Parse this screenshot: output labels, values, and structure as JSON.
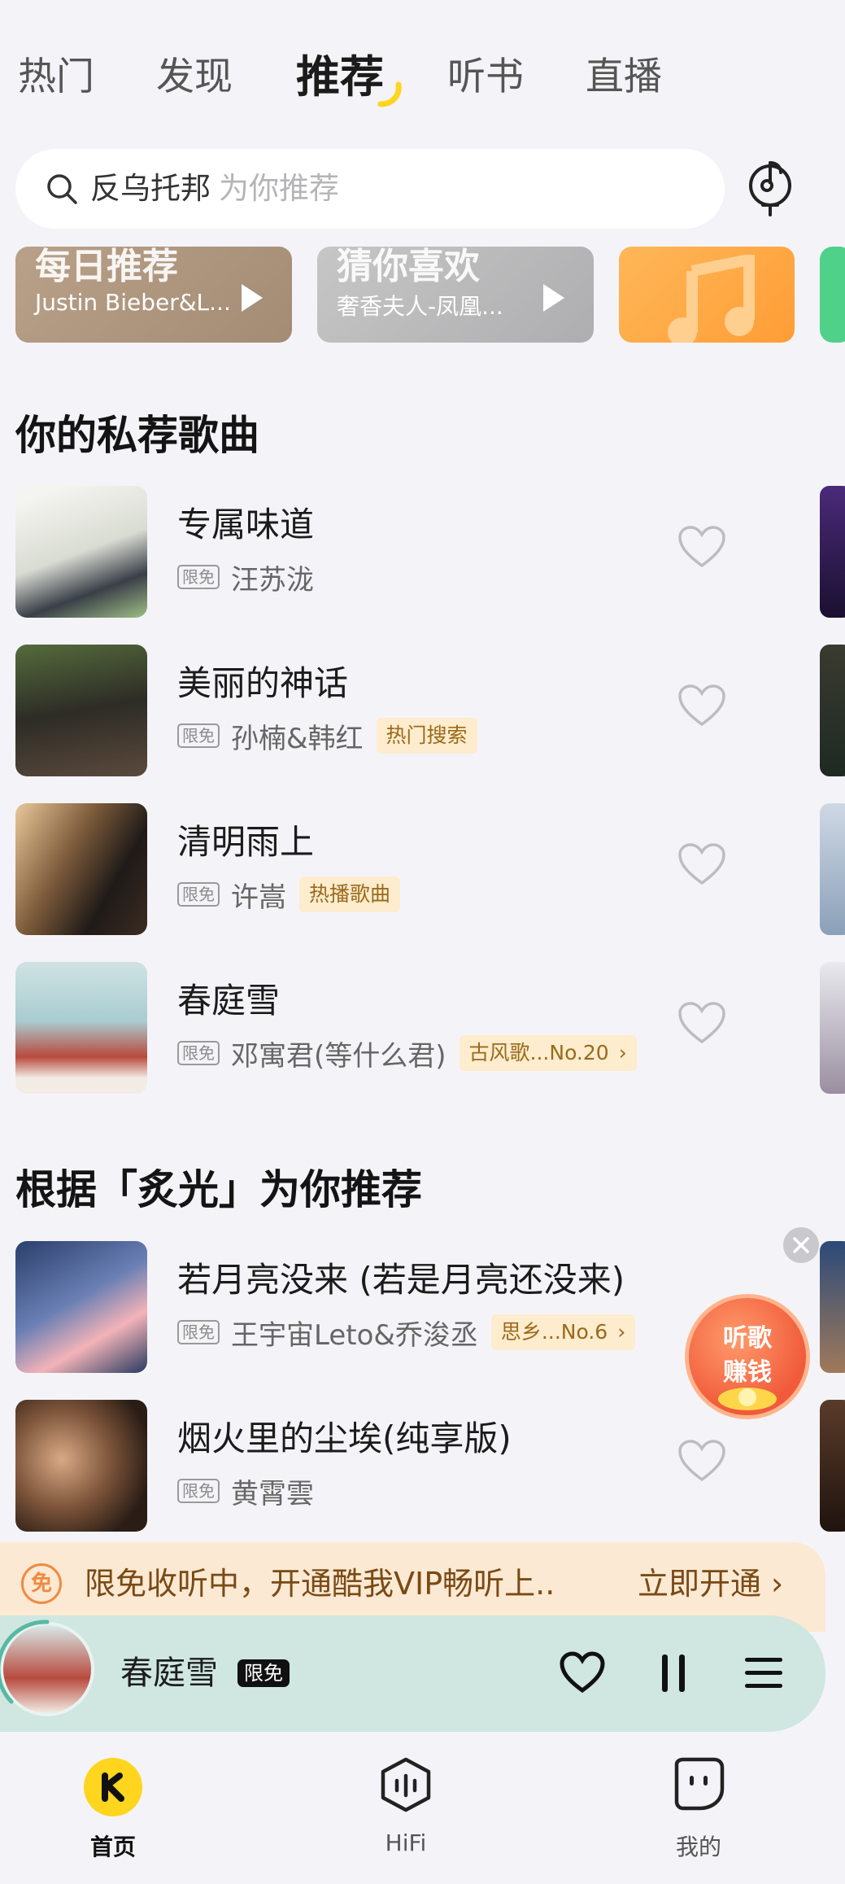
{
  "top_tabs": [
    {
      "label": "热门"
    },
    {
      "label": "发现"
    },
    {
      "label": "推荐"
    },
    {
      "label": "听书"
    },
    {
      "label": "直播"
    }
  ],
  "search": {
    "query": "反乌托邦",
    "placeholder": "为你推荐"
  },
  "banners": [
    {
      "title": "每日推荐",
      "subtitle": "Justin Bieber&L..."
    },
    {
      "title": "猜你喜欢",
      "subtitle": "奢香夫人-凤凰..."
    }
  ],
  "section1": {
    "title": "你的私荐歌曲",
    "songs": [
      {
        "name": "专属味道",
        "free": "限免",
        "artist": "汪苏泷",
        "tag": ""
      },
      {
        "name": "美丽的神话",
        "free": "限免",
        "artist": "孙楠&韩红",
        "tag": "热门搜索"
      },
      {
        "name": "清明雨上",
        "free": "限免",
        "artist": "许嵩",
        "tag": "热播歌曲"
      },
      {
        "name": "春庭雪",
        "free": "限免",
        "artist": "邓寓君(等什么君)",
        "tag": "古风歌...No.20"
      }
    ]
  },
  "section2": {
    "title": "根据「炙光」为你推荐",
    "songs": [
      {
        "name": "若月亮没来 (若是月亮还没来)",
        "free": "限免",
        "artist": "王宇宙Leto&乔浚丞",
        "tag": "思乡...No.6"
      },
      {
        "name": "烟火里的尘埃(纯享版)",
        "free": "限免",
        "artist": "黄霄雲",
        "tag": ""
      }
    ]
  },
  "earn": {
    "line1": "听歌",
    "line2": "赚钱"
  },
  "vip": {
    "icon": "免",
    "text": "限免收听中，开通酷我VIP畅听上..",
    "cta": "立即开通"
  },
  "player": {
    "title": "春庭雪",
    "badge": "限免"
  },
  "bottom_nav": [
    {
      "label": "首页"
    },
    {
      "label": "HiFi"
    },
    {
      "label": "我的"
    }
  ],
  "colors": {
    "accent": "#ffd51e",
    "vip_bg": "#fbe9d3",
    "player_bg": "#cfe7e0",
    "tag_bg": "#fdeccd"
  }
}
